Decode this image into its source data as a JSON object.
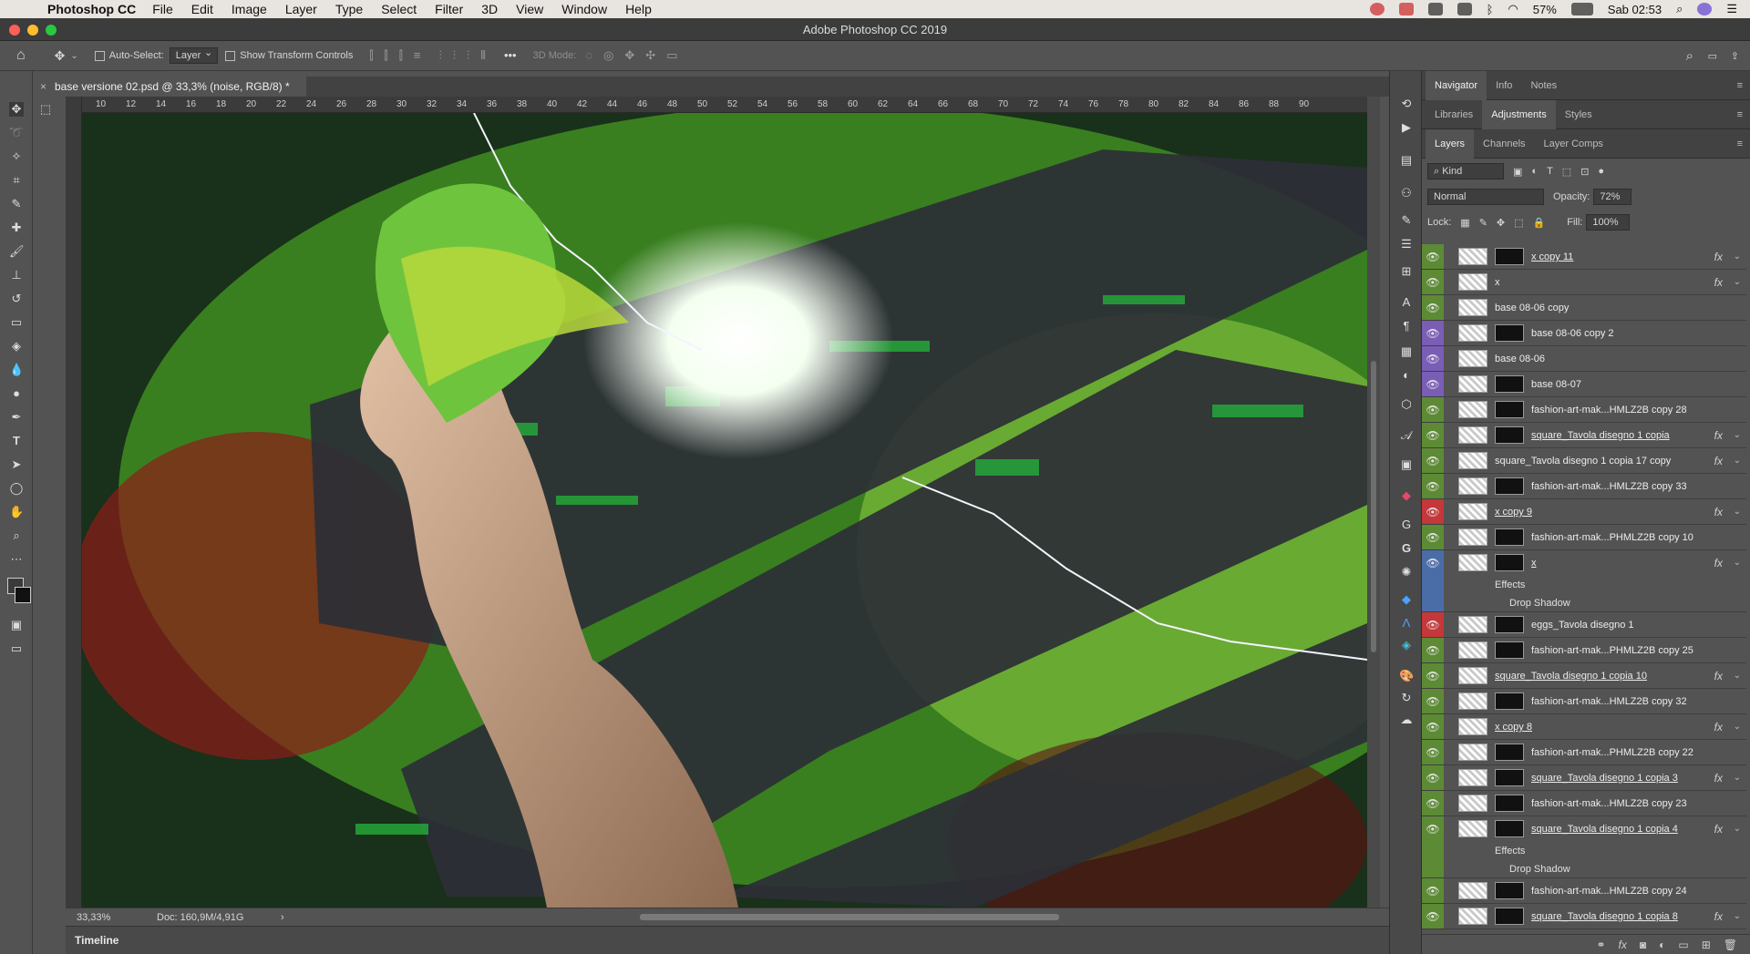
{
  "menubar": {
    "app_name": "Photoshop CC",
    "items": [
      "File",
      "Edit",
      "Image",
      "Layer",
      "Type",
      "Select",
      "Filter",
      "3D",
      "View",
      "Window",
      "Help"
    ],
    "battery": "57%",
    "clock": "Sab 02:53"
  },
  "window": {
    "title": "Adobe Photoshop CC 2019"
  },
  "options_bar": {
    "auto_select_label": "Auto-Select:",
    "auto_select_value": "Layer",
    "transform_label": "Show Transform Controls",
    "mode3d_label": "3D Mode:"
  },
  "document": {
    "tab_title": "base versione 02.psd @ 33,3% (noise, RGB/8) *",
    "zoom": "33,33%",
    "doc_size": "Doc: 160,9M/4,91G"
  },
  "ruler_labels": [
    "10",
    "12",
    "14",
    "16",
    "18",
    "20",
    "22",
    "24",
    "26",
    "28",
    "30",
    "32",
    "34",
    "36",
    "38",
    "40",
    "42",
    "44",
    "46",
    "48",
    "50",
    "52",
    "54",
    "56",
    "58",
    "60",
    "62",
    "64",
    "66",
    "68",
    "70",
    "72",
    "74",
    "76",
    "78",
    "80",
    "82",
    "84",
    "86",
    "88",
    "90"
  ],
  "timeline": {
    "label": "Timeline"
  },
  "panels": {
    "tabs_top": [
      "Navigator",
      "Info",
      "Notes"
    ],
    "tabs_mid": [
      "Libraries",
      "Adjustments",
      "Styles"
    ],
    "tabs_layers": [
      "Layers",
      "Channels",
      "Layer Comps"
    ],
    "kind_label": "Kind",
    "blend_mode": "Normal",
    "opacity_label": "Opacity:",
    "opacity_value": "72%",
    "lock_label": "Lock:",
    "fill_label": "Fill:",
    "fill_value": "100%"
  },
  "layers": [
    {
      "name": "x copy 11",
      "eye": "#5d8a35",
      "mask": true,
      "fx": true,
      "underline": true
    },
    {
      "name": "x",
      "eye": "#5d8a35",
      "mask": false,
      "fx": true,
      "underline": false
    },
    {
      "name": "base 08-06 copy",
      "eye": "#5d8a35",
      "mask": false,
      "fx": false,
      "underline": false
    },
    {
      "name": "base 08-06 copy 2",
      "eye": "#7a5db5",
      "mask": true,
      "fx": false,
      "underline": false
    },
    {
      "name": "base 08-06",
      "eye": "#7a5db5",
      "mask": false,
      "fx": false,
      "underline": false
    },
    {
      "name": "base 08-07",
      "eye": "#7a5db5",
      "mask": true,
      "fx": false,
      "underline": false
    },
    {
      "name": "fashion-art-mak...HMLZ2B copy 28",
      "eye": "#5d8a35",
      "mask": true,
      "fx": false,
      "underline": false
    },
    {
      "name": "square_Tavola disegno 1 copia",
      "eye": "#5d8a35",
      "mask": true,
      "fx": true,
      "underline": true
    },
    {
      "name": "square_Tavola disegno 1 copia 17 copy",
      "eye": "#5d8a35",
      "mask": false,
      "fx": true,
      "underline": false
    },
    {
      "name": "fashion-art-mak...HMLZ2B copy 33",
      "eye": "#5d8a35",
      "mask": true,
      "fx": false,
      "underline": false
    },
    {
      "name": "x copy 9",
      "eye": "#c4373a",
      "mask": false,
      "fx": true,
      "underline": true
    },
    {
      "name": "fashion-art-mak...PHMLZ2B copy 10",
      "eye": "#5d8a35",
      "mask": true,
      "fx": false,
      "underline": false
    },
    {
      "name": "x",
      "eye": "#4a6da8",
      "mask": true,
      "fx": true,
      "underline": true,
      "effects": [
        "Effects",
        "Drop Shadow"
      ]
    },
    {
      "name": "eggs_Tavola disegno 1",
      "eye": "#c4373a",
      "mask": true,
      "fx": false,
      "underline": false
    },
    {
      "name": "fashion-art-mak...PHMLZ2B copy 25",
      "eye": "#5d8a35",
      "mask": true,
      "fx": false,
      "underline": false
    },
    {
      "name": "square_Tavola disegno 1 copia 10",
      "eye": "#5d8a35",
      "mask": false,
      "fx": true,
      "underline": true
    },
    {
      "name": "fashion-art-mak...HMLZ2B copy 32",
      "eye": "#5d8a35",
      "mask": true,
      "fx": false,
      "underline": false
    },
    {
      "name": "x copy 8",
      "eye": "#5d8a35",
      "mask": false,
      "fx": true,
      "underline": true
    },
    {
      "name": "fashion-art-mak...PHMLZ2B copy 22",
      "eye": "#5d8a35",
      "mask": true,
      "fx": false,
      "underline": false
    },
    {
      "name": "square_Tavola disegno 1 copia 3",
      "eye": "#5d8a35",
      "mask": true,
      "fx": true,
      "underline": true
    },
    {
      "name": "fashion-art-mak...HMLZ2B copy 23",
      "eye": "#5d8a35",
      "mask": true,
      "fx": false,
      "underline": false
    },
    {
      "name": "square_Tavola disegno 1 copia 4",
      "eye": "#5d8a35",
      "mask": true,
      "fx": true,
      "underline": true,
      "effects": [
        "Effects",
        "Drop Shadow"
      ]
    },
    {
      "name": "fashion-art-mak...HMLZ2B copy 24",
      "eye": "#5d8a35",
      "mask": true,
      "fx": false,
      "underline": false
    },
    {
      "name": "square_Tavola disegno 1 copia 8",
      "eye": "#5d8a35",
      "mask": true,
      "fx": true,
      "underline": true
    }
  ]
}
